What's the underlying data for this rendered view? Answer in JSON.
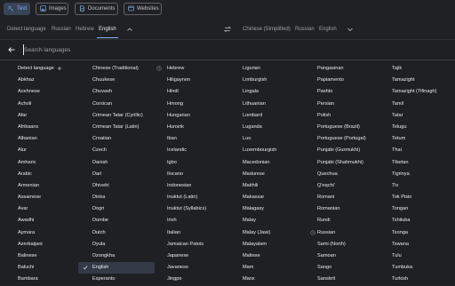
{
  "tabs": [
    {
      "label": "Text",
      "icon": "translate-icon",
      "active": true
    },
    {
      "label": "Images",
      "icon": "image-icon",
      "active": false
    },
    {
      "label": "Documents",
      "icon": "document-icon",
      "active": false
    },
    {
      "label": "Websites",
      "icon": "website-icon",
      "active": false
    }
  ],
  "source_langs": [
    "Detect language",
    "Russian",
    "Hebrew",
    "English"
  ],
  "target_langs": [
    "Chinese (Simplified)",
    "Russian",
    "English"
  ],
  "search": {
    "placeholder": "Search languages"
  },
  "columns": [
    [
      "Detect language",
      "Abkhaz",
      "Acehnese",
      "Acholi",
      "Afar",
      "Afrikaans",
      "Albanian",
      "Alur",
      "Amharic",
      "Arabic",
      "Armenian",
      "Assamese",
      "Avar",
      "Awadhi",
      "Aymara",
      "Azerbaijani",
      "Balinese",
      "Baluchi",
      "Bambara"
    ],
    [
      "Chinese (Traditional)",
      "Chuukese",
      "Chuvash",
      "Corsican",
      "Crimean Tatar (Cyrillic)",
      "Crimean Tatar (Latin)",
      "Croatian",
      "Czech",
      "Danish",
      "Dari",
      "Dhivehi",
      "Dinka",
      "Dogri",
      "Dombe",
      "Dutch",
      "Dyula",
      "Dzongkha",
      "English",
      "Esperanto"
    ],
    [
      "Hebrew",
      "Hiligaynon",
      "Hindi",
      "Hmong",
      "Hungarian",
      "Hunsrik",
      "Iban",
      "Icelandic",
      "Igbo",
      "Ilocano",
      "Indonesian",
      "Inuktut (Latin)",
      "Inuktut (Syllabics)",
      "Irish",
      "Italian",
      "Jamaican Patois",
      "Japanese",
      "Javanese",
      "Jingpo"
    ],
    [
      "Ligurian",
      "Limburgish",
      "Lingala",
      "Lithuanian",
      "Lombard",
      "Luganda",
      "Luo",
      "Luxembourgish",
      "Macedonian",
      "Madurese",
      "Maithili",
      "Makassar",
      "Malagasy",
      "Malay",
      "Malay (Jawi)",
      "Malayalam",
      "Maltese",
      "Mam",
      "Manx"
    ],
    [
      "Pangasinan",
      "Papiamento",
      "Pashto",
      "Persian",
      "Polish",
      "Portuguese (Brazil)",
      "Portuguese (Portugal)",
      "Punjabi (Gurmukhi)",
      "Punjabi (Shahmukhi)",
      "Quechua",
      "Q'eqchi'",
      "Romani",
      "Romanian",
      "Rundi",
      "Russian",
      "Sami (North)",
      "Samoan",
      "Sango",
      "Sanskrit"
    ],
    [
      "Tajik",
      "Tamazight",
      "Tamazight (Tifinagh)",
      "Tamil",
      "Tatar",
      "Telugu",
      "Tetum",
      "Thai",
      "Tibetan",
      "Tigrinya",
      "Tiv",
      "Tok Pisin",
      "Tongan",
      "Tshiluba",
      "Tsonga",
      "Tswana",
      "Tulu",
      "Tumbuka",
      "Turkish"
    ]
  ],
  "selected_language": "English",
  "colors": {
    "accent": "#8ab4f8",
    "background": "#202124"
  }
}
